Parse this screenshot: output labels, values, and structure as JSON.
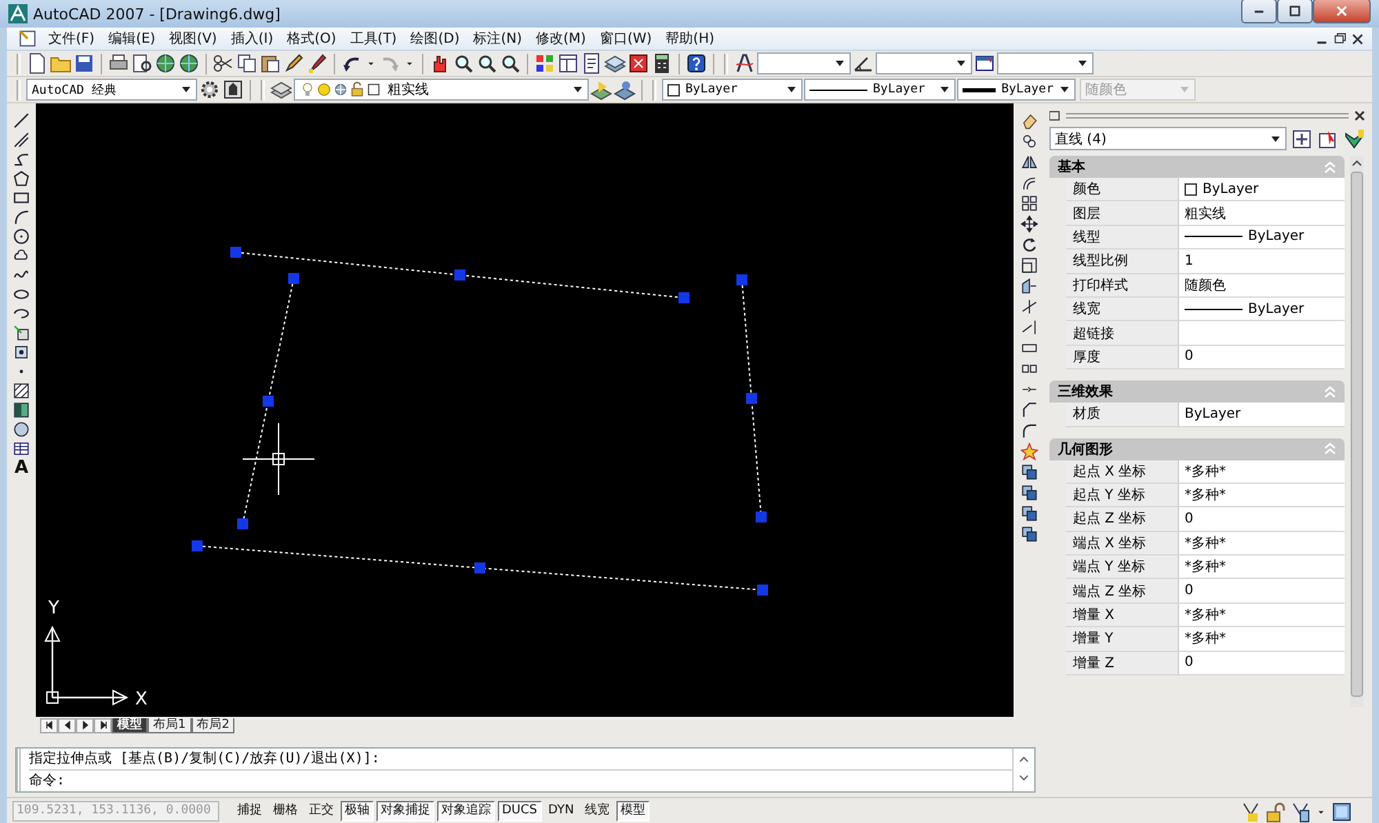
{
  "window": {
    "title": "AutoCAD 2007 - [Drawing6.dwg]"
  },
  "menu": [
    "文件(F)",
    "编辑(E)",
    "视图(V)",
    "插入(I)",
    "格式(O)",
    "工具(T)",
    "绘图(D)",
    "标注(N)",
    "修改(M)",
    "窗口(W)",
    "帮助(H)"
  ],
  "workspace_combo": {
    "value": "AutoCAD 经典"
  },
  "layer_combo": {
    "value": "粗实线"
  },
  "properties_toolbar": {
    "color_value": "ByLayer",
    "linetype": "ByLayer",
    "lineweight": "ByLayer",
    "plot_style": {
      "value": "随颜色",
      "disabled": true
    }
  },
  "draw_toolbar": {
    "text_tool": "A"
  },
  "canvas": {
    "ucs_y_label": "Y",
    "ucs_x_label": "X"
  },
  "layout_tabs": [
    {
      "label": "模型",
      "selected": true
    },
    {
      "label": "布局1",
      "selected": false
    },
    {
      "label": "布局2",
      "selected": false
    }
  ],
  "command_line": {
    "history": "指定拉伸点或 [基点(B)/复制(C)/放弃(U)/退出(X)]:",
    "prompt": "命令:"
  },
  "properties": {
    "selection": "直线 (4)",
    "sections": [
      {
        "title": "基本",
        "expanded": true,
        "rows": [
          {
            "label": "颜色",
            "value": "ByLayer",
            "kind": "color"
          },
          {
            "label": "图层",
            "value": "粗实线",
            "kind": "text"
          },
          {
            "label": "线型",
            "value": "ByLayer",
            "kind": "line"
          },
          {
            "label": "线型比例",
            "value": "1",
            "kind": "text"
          },
          {
            "label": "打印样式",
            "value": "随颜色",
            "kind": "text"
          },
          {
            "label": "线宽",
            "value": "ByLayer",
            "kind": "line"
          },
          {
            "label": "超链接",
            "kind": "text"
          },
          {
            "label": "厚度",
            "value": "0",
            "kind": "text"
          }
        ]
      },
      {
        "title": "三维效果",
        "expanded": true,
        "rows": [
          {
            "label": "材质",
            "value": "ByLayer",
            "kind": "text"
          }
        ]
      },
      {
        "title": "几何图形",
        "expanded": true,
        "rows": [
          {
            "label": "起点 X 坐标",
            "value": "*多种*",
            "kind": "text"
          },
          {
            "label": "起点 Y 坐标",
            "value": "*多种*",
            "kind": "text"
          },
          {
            "label": "起点 Z 坐标",
            "value": "0",
            "kind": "text"
          },
          {
            "label": "端点 X 坐标",
            "value": "*多种*",
            "kind": "text"
          },
          {
            "label": "端点 Y 坐标",
            "value": "*多种*",
            "kind": "text"
          },
          {
            "label": "端点 Z 坐标",
            "value": "0",
            "kind": "text"
          },
          {
            "label": "增量 X",
            "value": "*多种*",
            "kind": "text"
          },
          {
            "label": "增量 Y",
            "value": "*多种*",
            "kind": "text"
          },
          {
            "label": "增量 Z",
            "value": "0",
            "kind": "text"
          }
        ]
      }
    ]
  },
  "status_bar": {
    "coordinates": "109.5231, 153.1136, 0.0000",
    "toggles": [
      {
        "label": "捕捉",
        "on": false
      },
      {
        "label": "栅格",
        "on": false
      },
      {
        "label": "正交",
        "on": false
      },
      {
        "label": "极轴",
        "on": true
      },
      {
        "label": "对象捕捉",
        "on": true
      },
      {
        "label": "对象追踪",
        "on": true
      },
      {
        "label": "DUCS",
        "on": true
      },
      {
        "label": "DYN",
        "on": false
      },
      {
        "label": "线宽",
        "on": false
      },
      {
        "label": "模型",
        "on": true
      }
    ]
  }
}
